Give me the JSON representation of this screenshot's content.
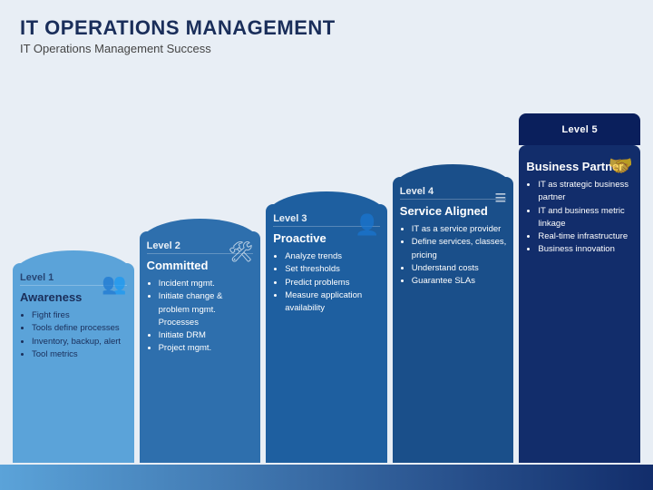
{
  "header": {
    "title": "IT OPERATIONS MANAGEMENT",
    "subtitle": "IT Operations Management Success"
  },
  "levels": [
    {
      "label": "Level 1",
      "name": "Awareness",
      "icon": "👥",
      "bullets": [
        "Fight fires",
        "Tools define processes",
        "Inventory, backup, alert",
        "Tool metrics"
      ]
    },
    {
      "label": "Level 2",
      "name": "Committed",
      "icon": "🛠",
      "bullets": [
        "Incident mgmt.",
        "Initiate change & problem mgmt. Processes",
        "Initiate DRM",
        "Project mgmt."
      ]
    },
    {
      "label": "Level 3",
      "name": "Proactive",
      "icon": "👤",
      "bullets": [
        "Analyze trends",
        "Set thresholds",
        "Predict problems",
        "Measure application availability"
      ]
    },
    {
      "label": "Level 4",
      "name": "Service Aligned",
      "icon": "≡",
      "bullets": [
        "IT as a service provider",
        "Define services, classes, pricing",
        "Understand costs",
        "Guarantee SLAs"
      ]
    },
    {
      "label": "Level 5",
      "name": "Business Partner",
      "icon": "🤝",
      "bullets": [
        "IT as strategic business partner",
        "IT and business metric linkage",
        "Real-time infrastructure",
        "Business innovation"
      ]
    }
  ],
  "bottom": {}
}
